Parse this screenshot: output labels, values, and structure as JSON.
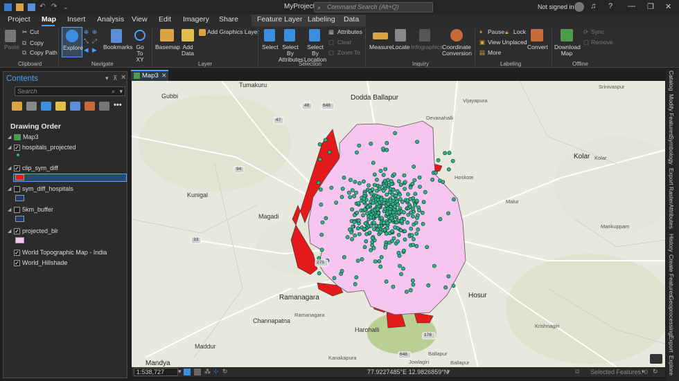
{
  "titlebar": {
    "title": "MyProject",
    "search_placeholder": "Command Search (Alt+Q)",
    "signin": "Not signed in"
  },
  "tabs": {
    "project": "Project",
    "map": "Map",
    "insert": "Insert",
    "analysis": "Analysis",
    "view": "View",
    "edit": "Edit",
    "imagery": "Imagery",
    "share": "Share",
    "feature_layer": "Feature Layer",
    "labeling": "Labeling",
    "data": "Data"
  },
  "ribbon": {
    "paste": "Paste",
    "cut": "Cut",
    "copy": "Copy",
    "copy_path": "Copy Path",
    "clipboard": "Clipboard",
    "explore": "Explore",
    "bookmarks": "Bookmarks",
    "goto": "Go To XY",
    "navigate": "Navigate",
    "basemap": "Basemap",
    "add_data": "Add Data",
    "add_graphics": "Add Graphics Layer",
    "layer": "Layer",
    "select": "Select",
    "select_by_attr": "Select By Attributes",
    "select_by_loc": "Select By Location",
    "attributes": "Attributes",
    "clear": "Clear",
    "zoom_to": "Zoom To",
    "selection": "Selection",
    "measure": "Measure",
    "locate": "Locate",
    "infographics": "Infographics",
    "coordinate": "Coordinate Conversion",
    "inquiry": "Inquiry",
    "pause": "Pause",
    "lock": "Lock",
    "view_unplaced": "View Unplaced",
    "more": "More",
    "convert": "Convert",
    "labeling_grp": "Labeling",
    "download_map": "Download Map",
    "sync": "Sync",
    "remove": "Remove",
    "offline": "Offline"
  },
  "contents": {
    "title": "Contents",
    "search_placeholder": "Search",
    "drawing_order": "Drawing Order",
    "layers": [
      {
        "name": "Map3",
        "checked": false
      },
      {
        "name": "hospitals_projected",
        "checked": true
      },
      {
        "name": "clip_sym_diff",
        "checked": true,
        "color": "#e31a1c"
      },
      {
        "name": "sym_diff_hospitals",
        "checked": false,
        "color": "#1f3a6e"
      },
      {
        "name": "5km_buffer",
        "checked": false,
        "color": "#1f3a6e"
      },
      {
        "name": "projected_blr",
        "checked": true,
        "color": "#f7c6f0"
      },
      {
        "name": "World Topographic Map - India",
        "checked": true
      },
      {
        "name": "World_Hillshade",
        "checked": true
      }
    ]
  },
  "map": {
    "tab": "Map3",
    "places": {
      "tumakuru": "Tumakuru",
      "gubbi": "Gubbi",
      "kunigal": "Kunigal",
      "magadi": "Magadi",
      "ramanagara": "Ramanagara",
      "ramanagara2": "Ramanagara",
      "channapatna": "Channapatna",
      "maddur": "Maddur",
      "mandya": "Mandya",
      "harohalli": "Harohalli",
      "kanakapura": "Kanakapura",
      "doddaballapur": "Dodda Ballapur",
      "devanahalli": "Devanahalli",
      "vijayapura": "Vijayapura",
      "hoskote": "Hoskote",
      "kolar": "Kolar",
      "kolar2": "Kolar",
      "malur": "Malur",
      "marikuppam": "Marikuppam",
      "hosur": "Hosur",
      "krishnagiri": "Krishnagiri",
      "srinivaspur": "Srinivaspur",
      "jowlagiri": "Jowlagiri",
      "ballapur": "Ballapur",
      "ballapur2": "Ballapur"
    },
    "roads": {
      "r48": "48",
      "r47": "47",
      "r648": "648",
      "r94": "94",
      "r33": "33",
      "r275": "275",
      "r178": "178",
      "r648b": "648"
    }
  },
  "status": {
    "scale": "1:538,727",
    "coords": "77.9227485°E 12.9826859°N",
    "selected": "Selected Features: 0"
  },
  "right_tabs": [
    "Catalog",
    "Modify Features",
    "Symbology",
    "Export Raster",
    "Attributes",
    "History",
    "Create Features",
    "Geoprocessing",
    "Export",
    "Explore"
  ],
  "colors": {
    "accent": "#4aa3ff",
    "blr": "#f7c6f0",
    "clip": "#e31a1c",
    "hospital": "#2fb38a"
  }
}
